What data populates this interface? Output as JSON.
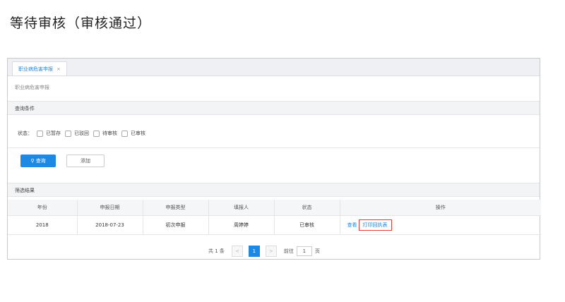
{
  "heading": "等待审核（审核通过）",
  "tab": {
    "label": "职业病危害申报",
    "close": "×"
  },
  "breadcrumb": "职业病危害申报",
  "query_panel": {
    "title": "查询条件",
    "status_label": "状态：",
    "options": [
      "已暂存",
      "已驳回",
      "待审核",
      "已审核"
    ],
    "query_button": "查询",
    "add_button": "添加"
  },
  "results": {
    "title": "筛选结果",
    "columns": [
      "年份",
      "申报日期",
      "申报类型",
      "填报人",
      "状态",
      "操作"
    ],
    "rows": [
      {
        "year": "2018",
        "date": "2018-07-23",
        "type": "初次申报",
        "filler": "周婷婷",
        "status": "已审核",
        "view": "查看",
        "print": "打印回执表"
      }
    ]
  },
  "pagination": {
    "total": "共 1 条",
    "prev": "<",
    "current": "1",
    "next": ">",
    "goto": "前往",
    "page_value": "1",
    "page_unit": "页"
  }
}
